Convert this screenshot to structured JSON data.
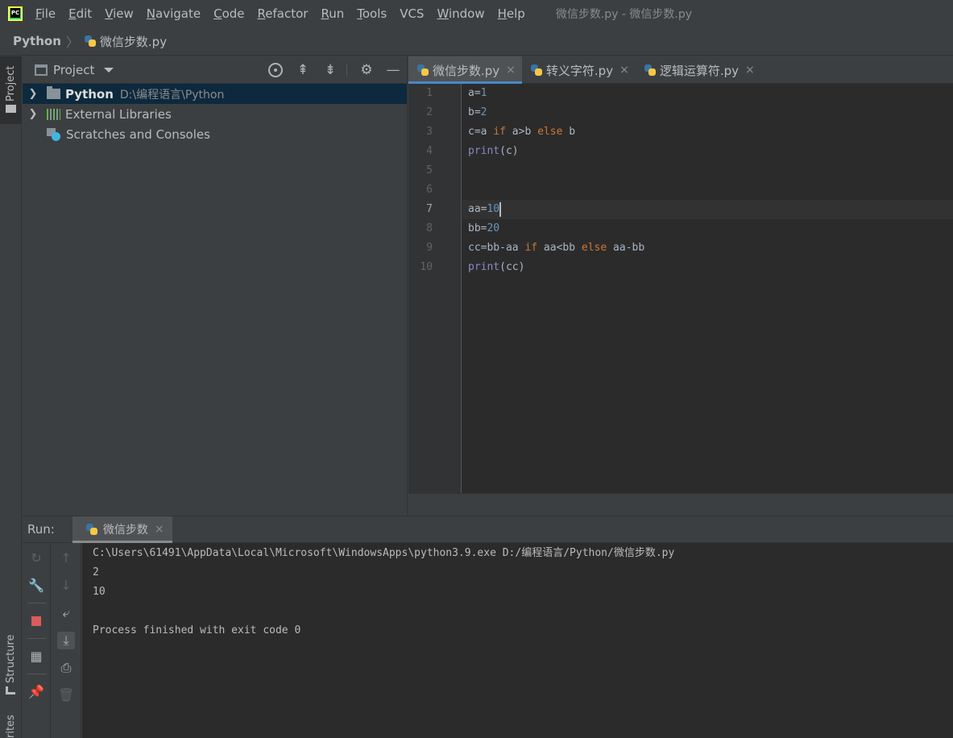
{
  "menu": {
    "items": [
      {
        "mnemonic": "F",
        "rest": "ile"
      },
      {
        "mnemonic": "E",
        "rest": "dit"
      },
      {
        "mnemonic": "V",
        "rest": "iew"
      },
      {
        "mnemonic": "N",
        "rest": "avigate"
      },
      {
        "mnemonic": "C",
        "rest": "ode"
      },
      {
        "mnemonic": "R",
        "rest": "efactor"
      },
      {
        "mnemonic": "R",
        "rest": "un"
      },
      {
        "mnemonic": "T",
        "rest": "ools"
      },
      {
        "mnemonic": "",
        "rest": "VCS"
      },
      {
        "mnemonic": "W",
        "rest": "indow"
      },
      {
        "mnemonic": "H",
        "rest": "elp"
      }
    ],
    "window_title": "微信步数.py - 微信步数.py"
  },
  "breadcrumb": {
    "project": "Python",
    "separator": "〉",
    "file": "微信步数.py"
  },
  "left_stripe": {
    "project_label": "Project",
    "structure_label": "Structure",
    "favorites_label": "rites"
  },
  "project_panel": {
    "title": "Project",
    "tree": [
      {
        "label": "Python",
        "path": "D:\\编程语言\\Python"
      },
      {
        "label": "External Libraries"
      },
      {
        "label": "Scratches and Consoles"
      }
    ]
  },
  "editor": {
    "tabs": [
      {
        "label": "微信步数.py",
        "active": true
      },
      {
        "label": "转义字符.py",
        "active": false
      },
      {
        "label": "逻辑运算符.py",
        "active": false
      }
    ],
    "close_glyph": "×",
    "current_line": 7,
    "lines": [
      {
        "n": "1",
        "tokens": [
          {
            "t": "a=",
            "c": ""
          },
          {
            "t": "1",
            "c": "num"
          }
        ]
      },
      {
        "n": "2",
        "tokens": [
          {
            "t": "b=",
            "c": ""
          },
          {
            "t": "2",
            "c": "num"
          }
        ]
      },
      {
        "n": "3",
        "tokens": [
          {
            "t": "c=a ",
            "c": ""
          },
          {
            "t": "if",
            "c": "kw"
          },
          {
            "t": " a>b ",
            "c": ""
          },
          {
            "t": "else",
            "c": "kw"
          },
          {
            "t": " b",
            "c": ""
          }
        ]
      },
      {
        "n": "4",
        "tokens": [
          {
            "t": "print",
            "c": "bi"
          },
          {
            "t": "(c)",
            "c": ""
          }
        ]
      },
      {
        "n": "5",
        "tokens": []
      },
      {
        "n": "6",
        "tokens": []
      },
      {
        "n": "7",
        "tokens": [
          {
            "t": "aa=",
            "c": ""
          },
          {
            "t": "10",
            "c": "num"
          }
        ]
      },
      {
        "n": "8",
        "tokens": [
          {
            "t": "bb=",
            "c": ""
          },
          {
            "t": "20",
            "c": "num"
          }
        ]
      },
      {
        "n": "9",
        "tokens": [
          {
            "t": "cc=bb-aa ",
            "c": ""
          },
          {
            "t": "if",
            "c": "kw"
          },
          {
            "t": " aa<bb ",
            "c": ""
          },
          {
            "t": "else",
            "c": "kw"
          },
          {
            "t": " aa-bb",
            "c": ""
          }
        ]
      },
      {
        "n": "10",
        "tokens": [
          {
            "t": "print",
            "c": "bi"
          },
          {
            "t": "(cc)",
            "c": ""
          }
        ]
      }
    ]
  },
  "run": {
    "label": "Run:",
    "tab_label": "微信步数",
    "console": [
      "C:\\Users\\61491\\AppData\\Local\\Microsoft\\WindowsApps\\python3.9.exe D:/编程语言/Python/微信步数.py",
      "2",
      "10",
      "",
      "Process finished with exit code 0"
    ]
  },
  "colors": {
    "keyword": "#cc7832",
    "number": "#6897bb",
    "builtin": "#8888c6",
    "selection": "#0d293e",
    "stop": "#db5c5c"
  }
}
